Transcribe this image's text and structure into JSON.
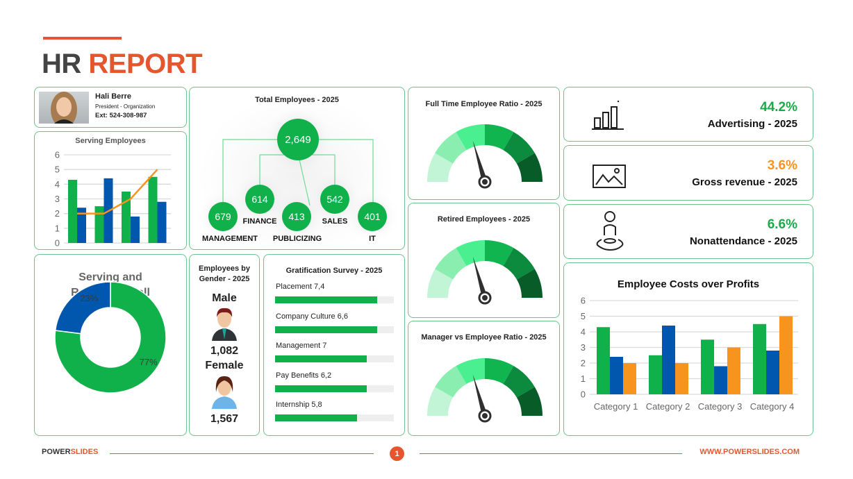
{
  "header": {
    "title_part1": "HR",
    "title_part2": "REPORT",
    "accent": "#e4572e"
  },
  "profile": {
    "name": "Hali Berre",
    "role": "President - Organization",
    "ext": "Ext: 524-308-987"
  },
  "serving_chart": {
    "type": "bar",
    "title": "Serving Employees",
    "ylim": [
      0,
      6
    ],
    "yticks": [
      "0",
      "1",
      "2",
      "3",
      "4",
      "5",
      "6"
    ],
    "series": [
      {
        "values": [
          4.3,
          2.5,
          3.5,
          4.5
        ],
        "color": "#10b14b"
      },
      {
        "values": [
          2.4,
          4.4,
          1.8,
          2.8
        ],
        "color": "#0057ad"
      },
      {
        "values": [
          2,
          2,
          3,
          5
        ],
        "color": "#f7941d",
        "kind": "line"
      }
    ]
  },
  "total": {
    "title": "Total Employees - 2025",
    "total": "2,649",
    "departments": [
      {
        "value": "679",
        "label": "MANAGEMENT"
      },
      {
        "value": "614",
        "label": "FINANCE"
      },
      {
        "value": "413",
        "label": "PUBLICIZING"
      },
      {
        "value": "542",
        "label": "SALES"
      },
      {
        "value": "401",
        "label": "IT"
      }
    ]
  },
  "gauges": [
    {
      "title": "Full Time Employee Ratio - 2025",
      "level": 0.41
    },
    {
      "title": "Retired Employees - 2025",
      "level": 0.41
    },
    {
      "title": "Manager vs Employee Ratio - 2025",
      "level": 0.41
    }
  ],
  "gauge_colors": [
    "#c1f5d6",
    "#8aeeb0",
    "#4af08f",
    "#10b550",
    "#0c8a3d",
    "#075c28"
  ],
  "kpis": [
    {
      "value": "44.2%",
      "label": "Advertising - 2025",
      "color": "#1aaa4a",
      "icon": "bar-chart-icon"
    },
    {
      "value": "3.6%",
      "label": "Gross revenue - 2025",
      "color": "#f7941d",
      "icon": "image-icon"
    },
    {
      "value": "6.6%",
      "label": "Nonattendance - 2025",
      "color": "#1aaa4a",
      "icon": "person-location-icon"
    }
  ],
  "donut": {
    "title_line1": "Serving and",
    "title_line2": "Retired Overall",
    "slices": [
      {
        "label": "77%",
        "value": 77,
        "color": "#10b14b"
      },
      {
        "label": "23%",
        "value": 23,
        "color": "#0057ad"
      }
    ]
  },
  "gender": {
    "title_line1": "Employees by",
    "title_line2": "Gender - 2025",
    "male_label": "Male",
    "male_count": "1,082",
    "female_label": "Female",
    "female_count": "1,567"
  },
  "survey": {
    "title": "Gratification Survey - 2025",
    "items": [
      {
        "label": "Placement 7,4",
        "fill": 0.86
      },
      {
        "label": "Company Culture 6,6",
        "fill": 0.86
      },
      {
        "label": "Management 7",
        "fill": 0.77
      },
      {
        "label": "Pay Benefits 6,2",
        "fill": 0.77
      },
      {
        "label": "Internship 5,8",
        "fill": 0.69
      }
    ]
  },
  "chart_data": {
    "type": "bar",
    "title": "Employee Costs over Profits",
    "categories": [
      "Category 1",
      "Category 2",
      "Category 3",
      "Category 4"
    ],
    "ylim": [
      0,
      6
    ],
    "yticks": [
      "0",
      "1",
      "2",
      "3",
      "4",
      "5",
      "6"
    ],
    "grid": true,
    "series": [
      {
        "values": [
          4.3,
          2.5,
          3.5,
          4.5
        ],
        "color": "#10b14b"
      },
      {
        "values": [
          2.4,
          4.4,
          1.8,
          2.8
        ],
        "color": "#0057ad"
      },
      {
        "values": [
          2,
          2,
          3,
          5
        ],
        "color": "#f7941d"
      }
    ]
  },
  "footer": {
    "brand1": "POWER",
    "brand2": "SLIDES",
    "page": "1",
    "url": "WWW.POWERSLIDES.COM"
  }
}
